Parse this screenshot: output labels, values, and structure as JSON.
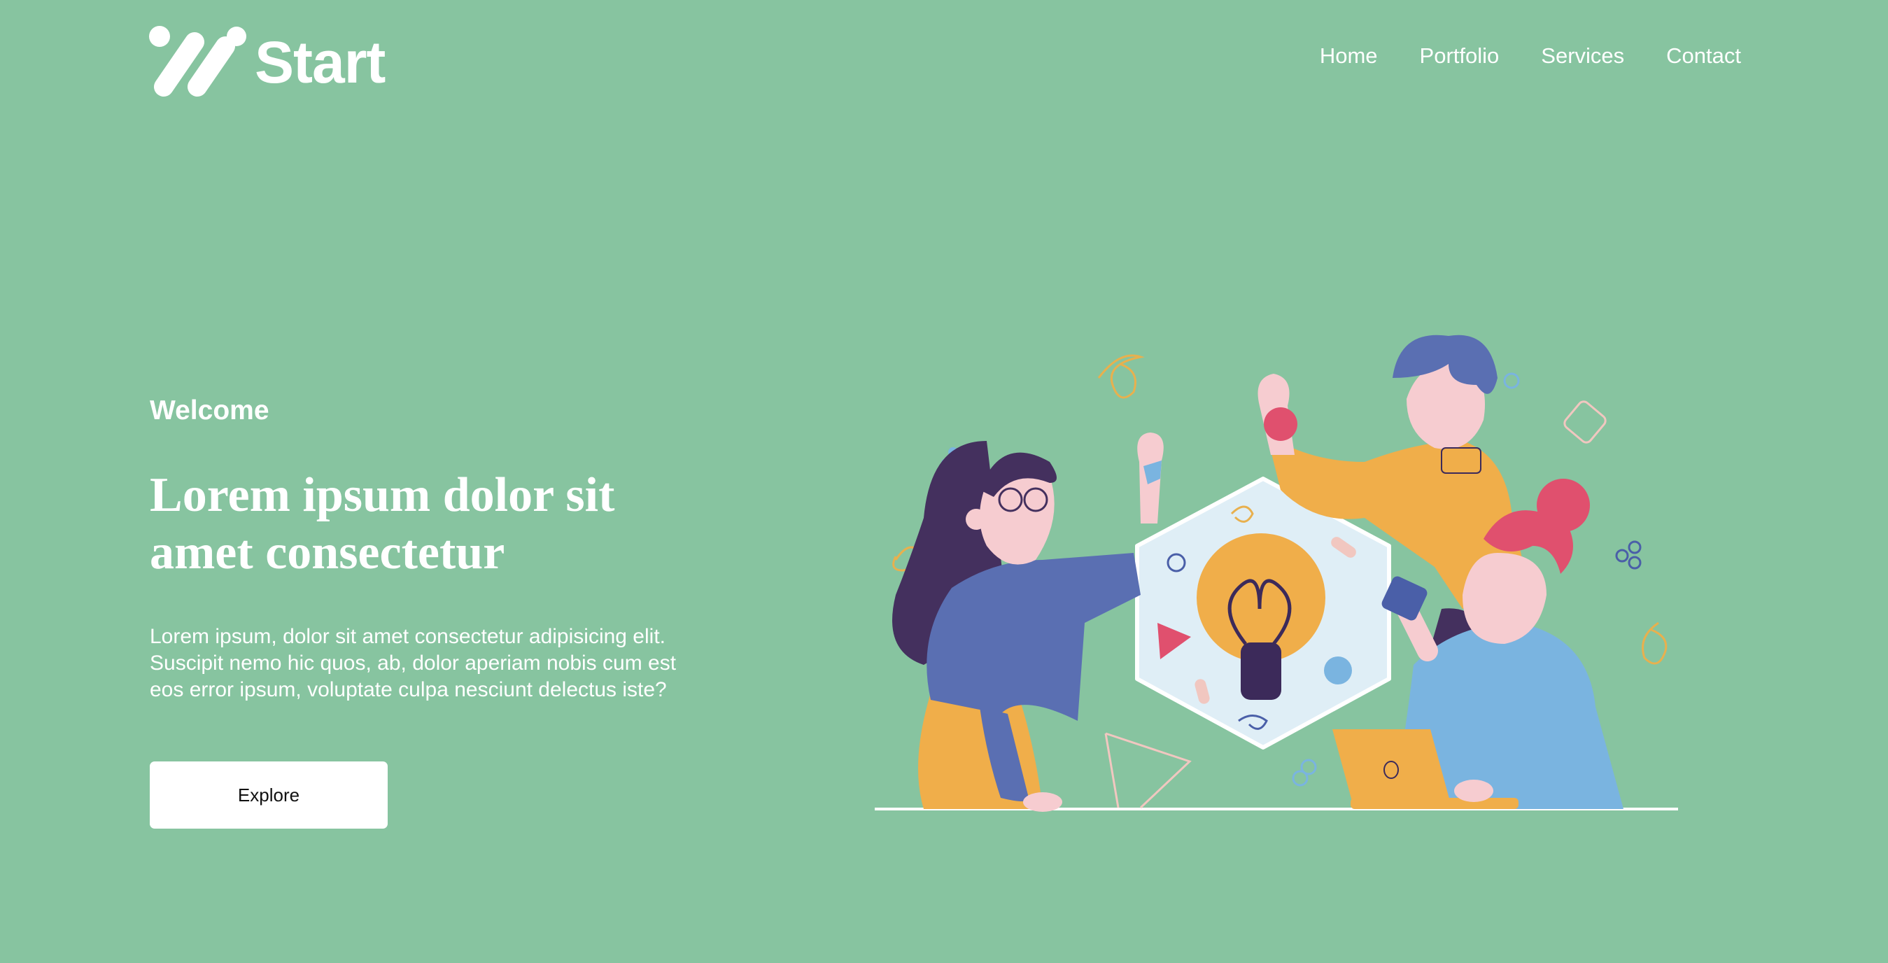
{
  "brand": {
    "name": "Start"
  },
  "nav": {
    "items": [
      {
        "label": "Home"
      },
      {
        "label": "Portfolio"
      },
      {
        "label": "Services"
      },
      {
        "label": "Contact"
      }
    ]
  },
  "hero": {
    "eyebrow": "Welcome",
    "headline_line1": "Lorem ipsum dolor sit",
    "headline_line2": "amet consectetur",
    "body": "Lorem ipsum, dolor sit amet consectetur adipisicing elit. Suscipit nemo hic quos, ab, dolor aperiam nobis cum est eos error ipsum, voluptate culpa nesciunt delectus iste?",
    "cta_label": "Explore"
  },
  "theme": {
    "background": "#87c4a0",
    "text": "#ffffff",
    "button_bg": "#ffffff",
    "button_text": "#111111"
  },
  "illustration": {
    "icon": "team-brainstorm-lightbulb-illustration"
  }
}
